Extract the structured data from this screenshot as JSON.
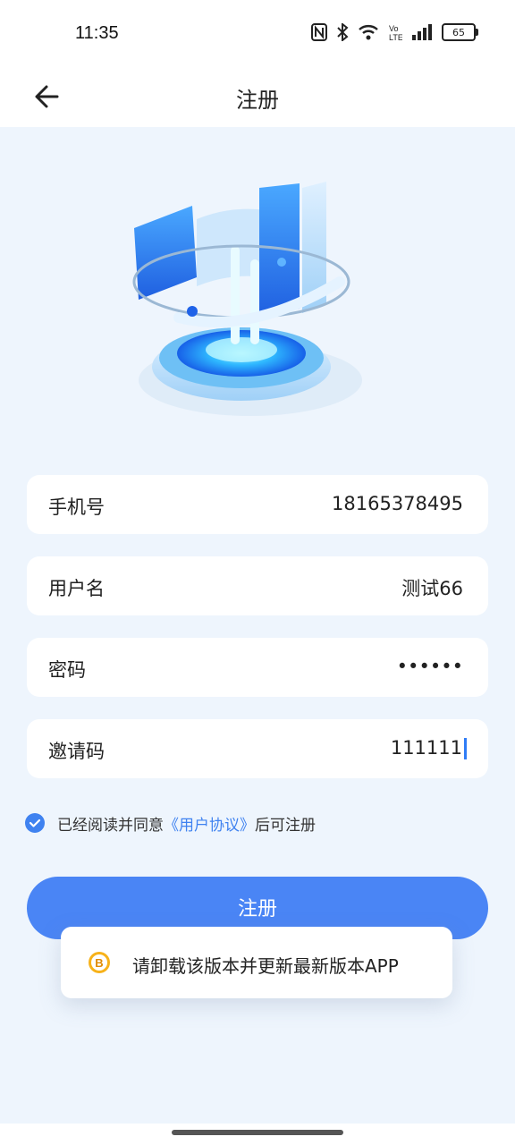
{
  "status": {
    "time": "11:35",
    "battery": "65",
    "icons": [
      "nfc-icon",
      "bluetooth-icon",
      "wifi-icon",
      "volte-icon",
      "signal-icon",
      "battery-icon"
    ]
  },
  "nav": {
    "title": "注册",
    "back_icon": "arrow-left-icon"
  },
  "form": {
    "phone": {
      "label": "手机号",
      "value": "18165378495"
    },
    "username": {
      "label": "用户名",
      "value": "测试66"
    },
    "password": {
      "label": "密码",
      "value": "••••••"
    },
    "invite": {
      "label": "邀请码",
      "value": "111111"
    }
  },
  "agreement": {
    "checked": true,
    "prefix": "已经阅读并同意",
    "link": "《用户协议》",
    "suffix": "后可注册"
  },
  "register_button": "注册",
  "toast": {
    "icon": "bitcoin-coin-icon",
    "text": "请卸载该版本并更新最新版本APP"
  },
  "colors": {
    "primary": "#4a85f5",
    "link": "#3f82f0",
    "background": "#eef5fd"
  }
}
